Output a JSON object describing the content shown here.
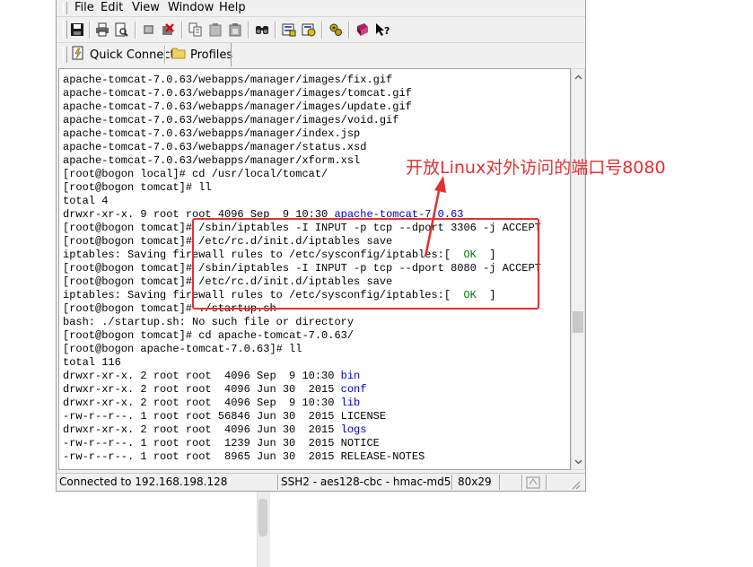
{
  "menu": [
    "File",
    "Edit",
    "View",
    "Window",
    "Help"
  ],
  "toolbar": {
    "icons": [
      "save-icon",
      "print-icon",
      "print-preview-icon",
      "disconnect-icon",
      "reconnect-icon",
      "copy-icon",
      "paste-icon",
      "paste-all-icon",
      "find-icon",
      "session-options-icon",
      "global-options-icon",
      "keymap-icon",
      "help-book-icon",
      "context-help-icon"
    ]
  },
  "quickbar": {
    "quick_connect": "Quick Connect",
    "profiles": "Profiles"
  },
  "terminal": {
    "lines": [
      [
        {
          "t": "apache-tomcat-7.0.63/webapps/manager/images/fix.gif"
        }
      ],
      [
        {
          "t": "apache-tomcat-7.0.63/webapps/manager/images/tomcat.gif"
        }
      ],
      [
        {
          "t": "apache-tomcat-7.0.63/webapps/manager/images/update.gif"
        }
      ],
      [
        {
          "t": "apache-tomcat-7.0.63/webapps/manager/images/void.gif"
        }
      ],
      [
        {
          "t": "apache-tomcat-7.0.63/webapps/manager/index.jsp"
        }
      ],
      [
        {
          "t": "apache-tomcat-7.0.63/webapps/manager/status.xsd"
        }
      ],
      [
        {
          "t": "apache-tomcat-7.0.63/webapps/manager/xform.xsl"
        }
      ],
      [
        {
          "t": "[root@bogon local]# cd /usr/local/tomcat/"
        }
      ],
      [
        {
          "t": "[root@bogon tomcat]# ll"
        }
      ],
      [
        {
          "t": "total 4"
        }
      ],
      [
        {
          "t": "drwxr-xr-x. 9 root root 4096 Sep  9 10:30 "
        },
        {
          "t": "apache-tomcat-7.0.63",
          "c": "blue"
        }
      ],
      [
        {
          "t": "[root@bogon tomcat]# /sbin/iptables -I INPUT -p tcp --dport 3306 -j ACCEPT"
        }
      ],
      [
        {
          "t": "[root@bogon tomcat]# /etc/rc.d/init.d/iptables save"
        }
      ],
      [
        {
          "t": "iptables: Saving firewall rules to /etc/sysconfig/iptables:[  "
        },
        {
          "t": "OK",
          "c": "green"
        },
        {
          "t": "  ]"
        }
      ],
      [
        {
          "t": "[root@bogon tomcat]# /sbin/iptables -I INPUT -p tcp --dport 8080 -j ACCEPT"
        }
      ],
      [
        {
          "t": "[root@bogon tomcat]# /etc/rc.d/init.d/iptables save"
        }
      ],
      [
        {
          "t": "iptables: Saving firewall rules to /etc/sysconfig/iptables:[  "
        },
        {
          "t": "OK",
          "c": "green"
        },
        {
          "t": "  ]"
        }
      ],
      [
        {
          "t": "[root@bogon tomcat]# ./startup.sh"
        }
      ],
      [
        {
          "t": "bash: ./startup.sh: No such file or directory"
        }
      ],
      [
        {
          "t": "[root@bogon tomcat]# cd apache-tomcat-7.0.63/"
        }
      ],
      [
        {
          "t": "[root@bogon apache-tomcat-7.0.63]# ll"
        }
      ],
      [
        {
          "t": "total 116"
        }
      ],
      [
        {
          "t": "drwxr-xr-x. 2 root root  4096 Sep  9 10:30 "
        },
        {
          "t": "bin",
          "c": "blue"
        }
      ],
      [
        {
          "t": "drwxr-xr-x. 2 root root  4096 Jun 30  2015 "
        },
        {
          "t": "conf",
          "c": "blue"
        }
      ],
      [
        {
          "t": "drwxr-xr-x. 2 root root  4096 Sep  9 10:30 "
        },
        {
          "t": "lib",
          "c": "blue"
        }
      ],
      [
        {
          "t": "-rw-r--r--. 1 root root 56846 Jun 30  2015 LICENSE"
        }
      ],
      [
        {
          "t": "drwxr-xr-x. 2 root root  4096 Jun 30  2015 "
        },
        {
          "t": "logs",
          "c": "blue"
        }
      ],
      [
        {
          "t": "-rw-r--r--. 1 root root  1239 Jun 30  2015 NOTICE"
        }
      ],
      [
        {
          "t": "-rw-r--r--. 1 root root  8965 Jun 30  2015 RELEASE-NOTES"
        }
      ]
    ]
  },
  "status": {
    "connection": "Connected to 192.168.198.128",
    "cipher": "SSH2 - aes128-cbc - hmac-md5",
    "size": "80x29"
  },
  "annotation": {
    "text": "开放Linux对外访问的端口号8080",
    "color": "#e53030"
  }
}
